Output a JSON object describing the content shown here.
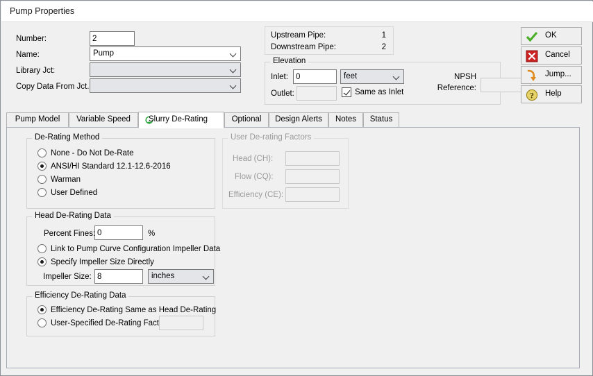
{
  "window": {
    "title": "Pump Properties"
  },
  "identification": {
    "number_label": "Number:",
    "number_value": "2",
    "name_label": "Name:",
    "name_value": "Pump",
    "library_jct_label": "Library Jct:",
    "library_jct_value": "",
    "copy_data_label": "Copy Data From Jct...",
    "copy_data_value": ""
  },
  "connections": {
    "upstream_label": "Upstream Pipe:",
    "upstream_value": "1",
    "downstream_label": "Downstream Pipe:",
    "downstream_value": "2"
  },
  "elevation": {
    "group_title": "Elevation",
    "inlet_label": "Inlet:",
    "inlet_value": "0",
    "units_value": "feet",
    "outlet_label": "Outlet:",
    "outlet_value": "",
    "same_as_inlet_label": "Same as Inlet",
    "same_as_inlet_checked": true,
    "npsh_label_line1": "NPSH",
    "npsh_label_line2": "Reference:",
    "npsh_value": ""
  },
  "buttons": [
    {
      "label": "OK",
      "icon": "green-check-icon"
    },
    {
      "label": "Cancel",
      "icon": "red-x-icon"
    },
    {
      "label": "Jump...",
      "icon": "orange-arrow-icon"
    },
    {
      "label": "Help",
      "icon": "yellow-question-icon"
    }
  ],
  "tabs": [
    {
      "label": "Pump Model",
      "active": false
    },
    {
      "label": "Variable Speed",
      "active": false
    },
    {
      "label": "Slurry De-Rating",
      "active": true,
      "icon": "green-recycle-icon"
    },
    {
      "label": "Optional",
      "active": false
    },
    {
      "label": "Design Alerts",
      "active": false
    },
    {
      "label": "Notes",
      "active": false
    },
    {
      "label": "Status",
      "active": false
    }
  ],
  "derating_method": {
    "group_title": "De-Rating Method",
    "options": [
      {
        "label": "None - Do Not De-Rate",
        "selected": false
      },
      {
        "label": "ANSI/HI Standard 12.1-12.6-2016",
        "selected": true
      },
      {
        "label": "Warman",
        "selected": false
      },
      {
        "label": "User Defined",
        "selected": false
      }
    ]
  },
  "user_derating_factors": {
    "group_title": "User De-rating Factors",
    "disabled": true,
    "fields": [
      {
        "label": "Head (CH):",
        "value": ""
      },
      {
        "label": "Flow (CQ):",
        "value": ""
      },
      {
        "label": "Efficiency (CE):",
        "value": ""
      }
    ]
  },
  "head_derating": {
    "group_title": "Head De-Rating Data",
    "percent_fines_label": "Percent Fines:",
    "percent_fines_value": "0",
    "percent_unit": "%",
    "options": [
      {
        "label": "Link to Pump Curve Configuration Impeller Data",
        "selected": false
      },
      {
        "label": "Specify Impeller Size Directly",
        "selected": true
      }
    ],
    "impeller_size_label": "Impeller Size:",
    "impeller_size_value": "8",
    "impeller_units_value": "inches"
  },
  "efficiency_derating": {
    "group_title": "Efficiency De-Rating Data",
    "options": [
      {
        "label": "Efficiency De-Rating Same as Head De-Rating",
        "selected": true
      },
      {
        "label": "User-Specified De-Rating Factor",
        "selected": false
      }
    ],
    "user_factor_value": ""
  },
  "colors": {
    "dialog_bg": "#f0f0f0",
    "titlebar_bg": "#ffffff",
    "accent_green": "#4caf2a",
    "accent_red": "#cc2222",
    "accent_orange": "#e08a1e",
    "accent_yellow": "#d9c24a",
    "disabled_text": "#9a9a9a"
  }
}
